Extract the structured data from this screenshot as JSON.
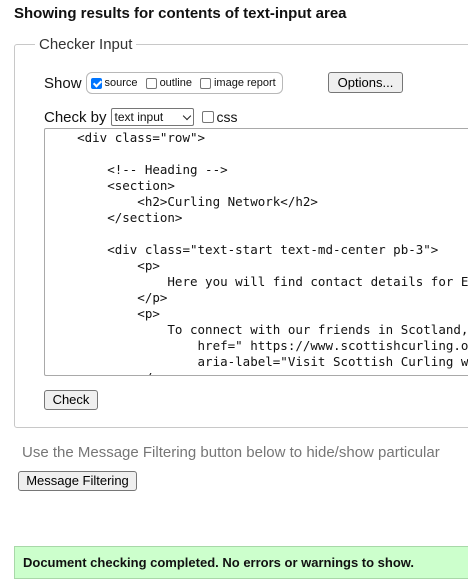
{
  "header": {
    "title": "Showing results for contents of text-input area"
  },
  "checker": {
    "legend": "Checker Input",
    "show_label": "Show",
    "show_options": [
      {
        "label": "source",
        "checked": true
      },
      {
        "label": "outline",
        "checked": false
      },
      {
        "label": "image report",
        "checked": false
      }
    ],
    "options_button": "Options...",
    "check_by_label": "Check by",
    "check_by_value": "text input",
    "css_label": "css",
    "css_checked": false,
    "code_lines": [
      "    <div class=\"row\">",
      "",
      "        <!-- Heading -->",
      "        <section>",
      "            <h2>Curling Network</h2>",
      "        </section>",
      "",
      "        <div class=\"text-start text-md-center pb-3\">",
      "            <p>",
      "                Here you will find contact details for E",
      "            </p>",
      "            <p>",
      "                To connect with our friends in Scotland,",
      "                    href=\" https://www.scottishcurling.o",
      "                    aria-label=\"Visit Scottish Curling w",
      "            </p>"
    ],
    "check_button": "Check"
  },
  "filtering": {
    "note": "Use the Message Filtering button below to hide/show particular",
    "button": "Message Filtering"
  },
  "status": {
    "message": "Document checking completed. No errors or warnings to show.",
    "color": "#ccffcc"
  }
}
